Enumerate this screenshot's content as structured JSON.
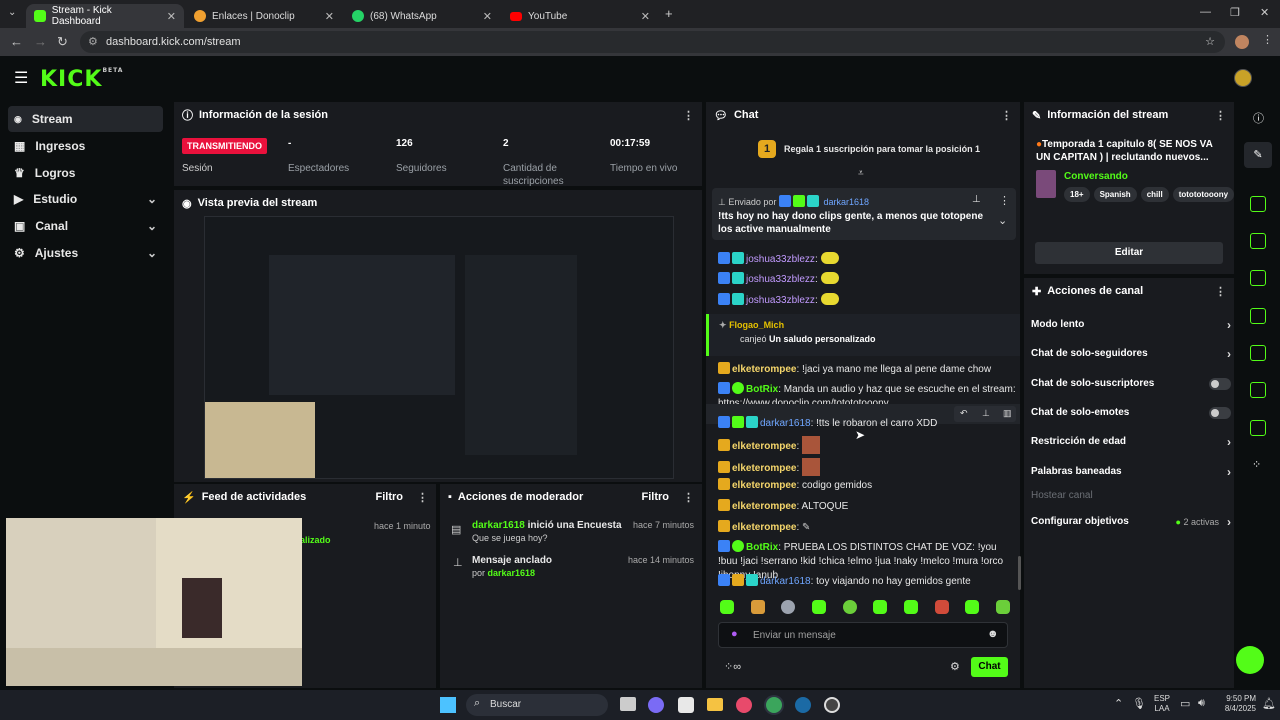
{
  "browser": {
    "tabs": [
      {
        "title": "Stream - Kick Dashboard"
      },
      {
        "title": "Enlaces | Donoclip"
      },
      {
        "title": "(68) WhatsApp"
      },
      {
        "title": "YouTube"
      }
    ],
    "url": "dashboard.kick.com/stream"
  },
  "logo": {
    "text": "KICK",
    "sup": "BETA"
  },
  "sidebar": {
    "items": [
      {
        "label": "Stream"
      },
      {
        "label": "Ingresos"
      },
      {
        "label": "Logros"
      },
      {
        "label": "Estudio"
      },
      {
        "label": "Canal"
      },
      {
        "label": "Ajustes"
      }
    ]
  },
  "session": {
    "title": "Información de la sesión",
    "live_badge": "TRANSMITIENDO",
    "session_label": "Sesión",
    "stats": [
      {
        "value": "-",
        "label": "Espectadores"
      },
      {
        "value": "126",
        "label": "Seguidores"
      },
      {
        "value": "2",
        "label": "Cantidad de suscripciones"
      },
      {
        "value": "00:17:59",
        "label": "Tiempo en vivo"
      }
    ]
  },
  "preview": {
    "title": "Vista previa del stream"
  },
  "activity": {
    "title": "Feed de actividades",
    "filter": "Filtro",
    "time": "hace 1 minuto",
    "partial": "alizado"
  },
  "modactions": {
    "title": "Acciones de moderador",
    "filter": "Filtro",
    "items": [
      {
        "user": "darkar1618",
        "action": " inició una Encuesta",
        "sub": "Que se juega hoy?",
        "time": "hace 7 minutos"
      },
      {
        "title": "Mensaje anclado",
        "by": "por ",
        "user": "darkar1618",
        "time": "hace 14 minutos"
      }
    ]
  },
  "chat": {
    "title": "Chat",
    "gift_banner": "Regala 1 suscripción para tomar la posición 1",
    "gift_num": "1",
    "pinned": {
      "by_label": "Enviado por",
      "user": "darkar1618",
      "text": "!tts hoy no hay dono clips gente, a menos que totopene los active manualmente"
    },
    "messages": [
      {
        "user": "joshua33zblezz",
        "text": ":"
      },
      {
        "user": "joshua33zblezz",
        "text": ":"
      },
      {
        "user": "joshua33zblezz",
        "text": ":"
      },
      {
        "user": "Flogao_Mich",
        "text": "canjeó ",
        "bold": "Un saludo personalizado"
      },
      {
        "user": "elketerompee",
        "text": ": !jaci ya mano me llega al pene dame chow"
      },
      {
        "user": "BotRix",
        "text": ": Manda un audio y haz que se escuche en el stream:",
        "link": "https://www.donoclip.com/totototooony"
      },
      {
        "user": "darkar1618",
        "text": ": !tts le robaron el carro XDD"
      },
      {
        "user": "elketerompee",
        "text": ":"
      },
      {
        "user": "elketerompee",
        "text": ":"
      },
      {
        "user": "elketerompee",
        "text": ": codigo gemidos"
      },
      {
        "user": "elketerompee",
        "text": ": ALTOQUE"
      },
      {
        "user": "elketerompee",
        "text": ":"
      },
      {
        "user": "BotRix",
        "text": ": PRUEBA LOS DISTINTOS CHAT DE VOZ: !you !buu !jaci !serrano !kid !chica !elmo !jua !naky !melco !mura !orco !jhonny !anub"
      },
      {
        "user": "darkar1618",
        "text": ": toy viajando no hay gemidos gente"
      }
    ],
    "input_placeholder": "Enviar un mensaje",
    "send_label": "Chat"
  },
  "stream_info": {
    "title": "Información del stream",
    "stream_title": "Temporada 1 capitulo 8( SE NOS VA UN CAPITAN ) | reclutando nuevos...",
    "category": "Conversando",
    "tags": [
      "18+",
      "Spanish",
      "chill",
      "totototooony"
    ],
    "edit_label": "Editar"
  },
  "channel_actions": {
    "title": "Acciones de canal",
    "items": [
      {
        "label": "Modo lento"
      },
      {
        "label": "Chat de solo-seguidores"
      },
      {
        "label": "Chat de solo-suscriptores"
      },
      {
        "label": "Chat de solo-emotes"
      },
      {
        "label": "Restricción de edad"
      },
      {
        "label": "Palabras baneadas"
      },
      {
        "label": "Hostear canal"
      },
      {
        "label": "Configurar objetivos",
        "extra": "2 activas"
      }
    ]
  },
  "taskbar": {
    "search": "Buscar",
    "lang": "ESP",
    "lang2": "LAA",
    "time": "9:50 PM",
    "date": "8/4/2025"
  },
  "colors": {
    "accent": "#53fc18",
    "live": "#e9113c",
    "panel": "#191b1f"
  }
}
